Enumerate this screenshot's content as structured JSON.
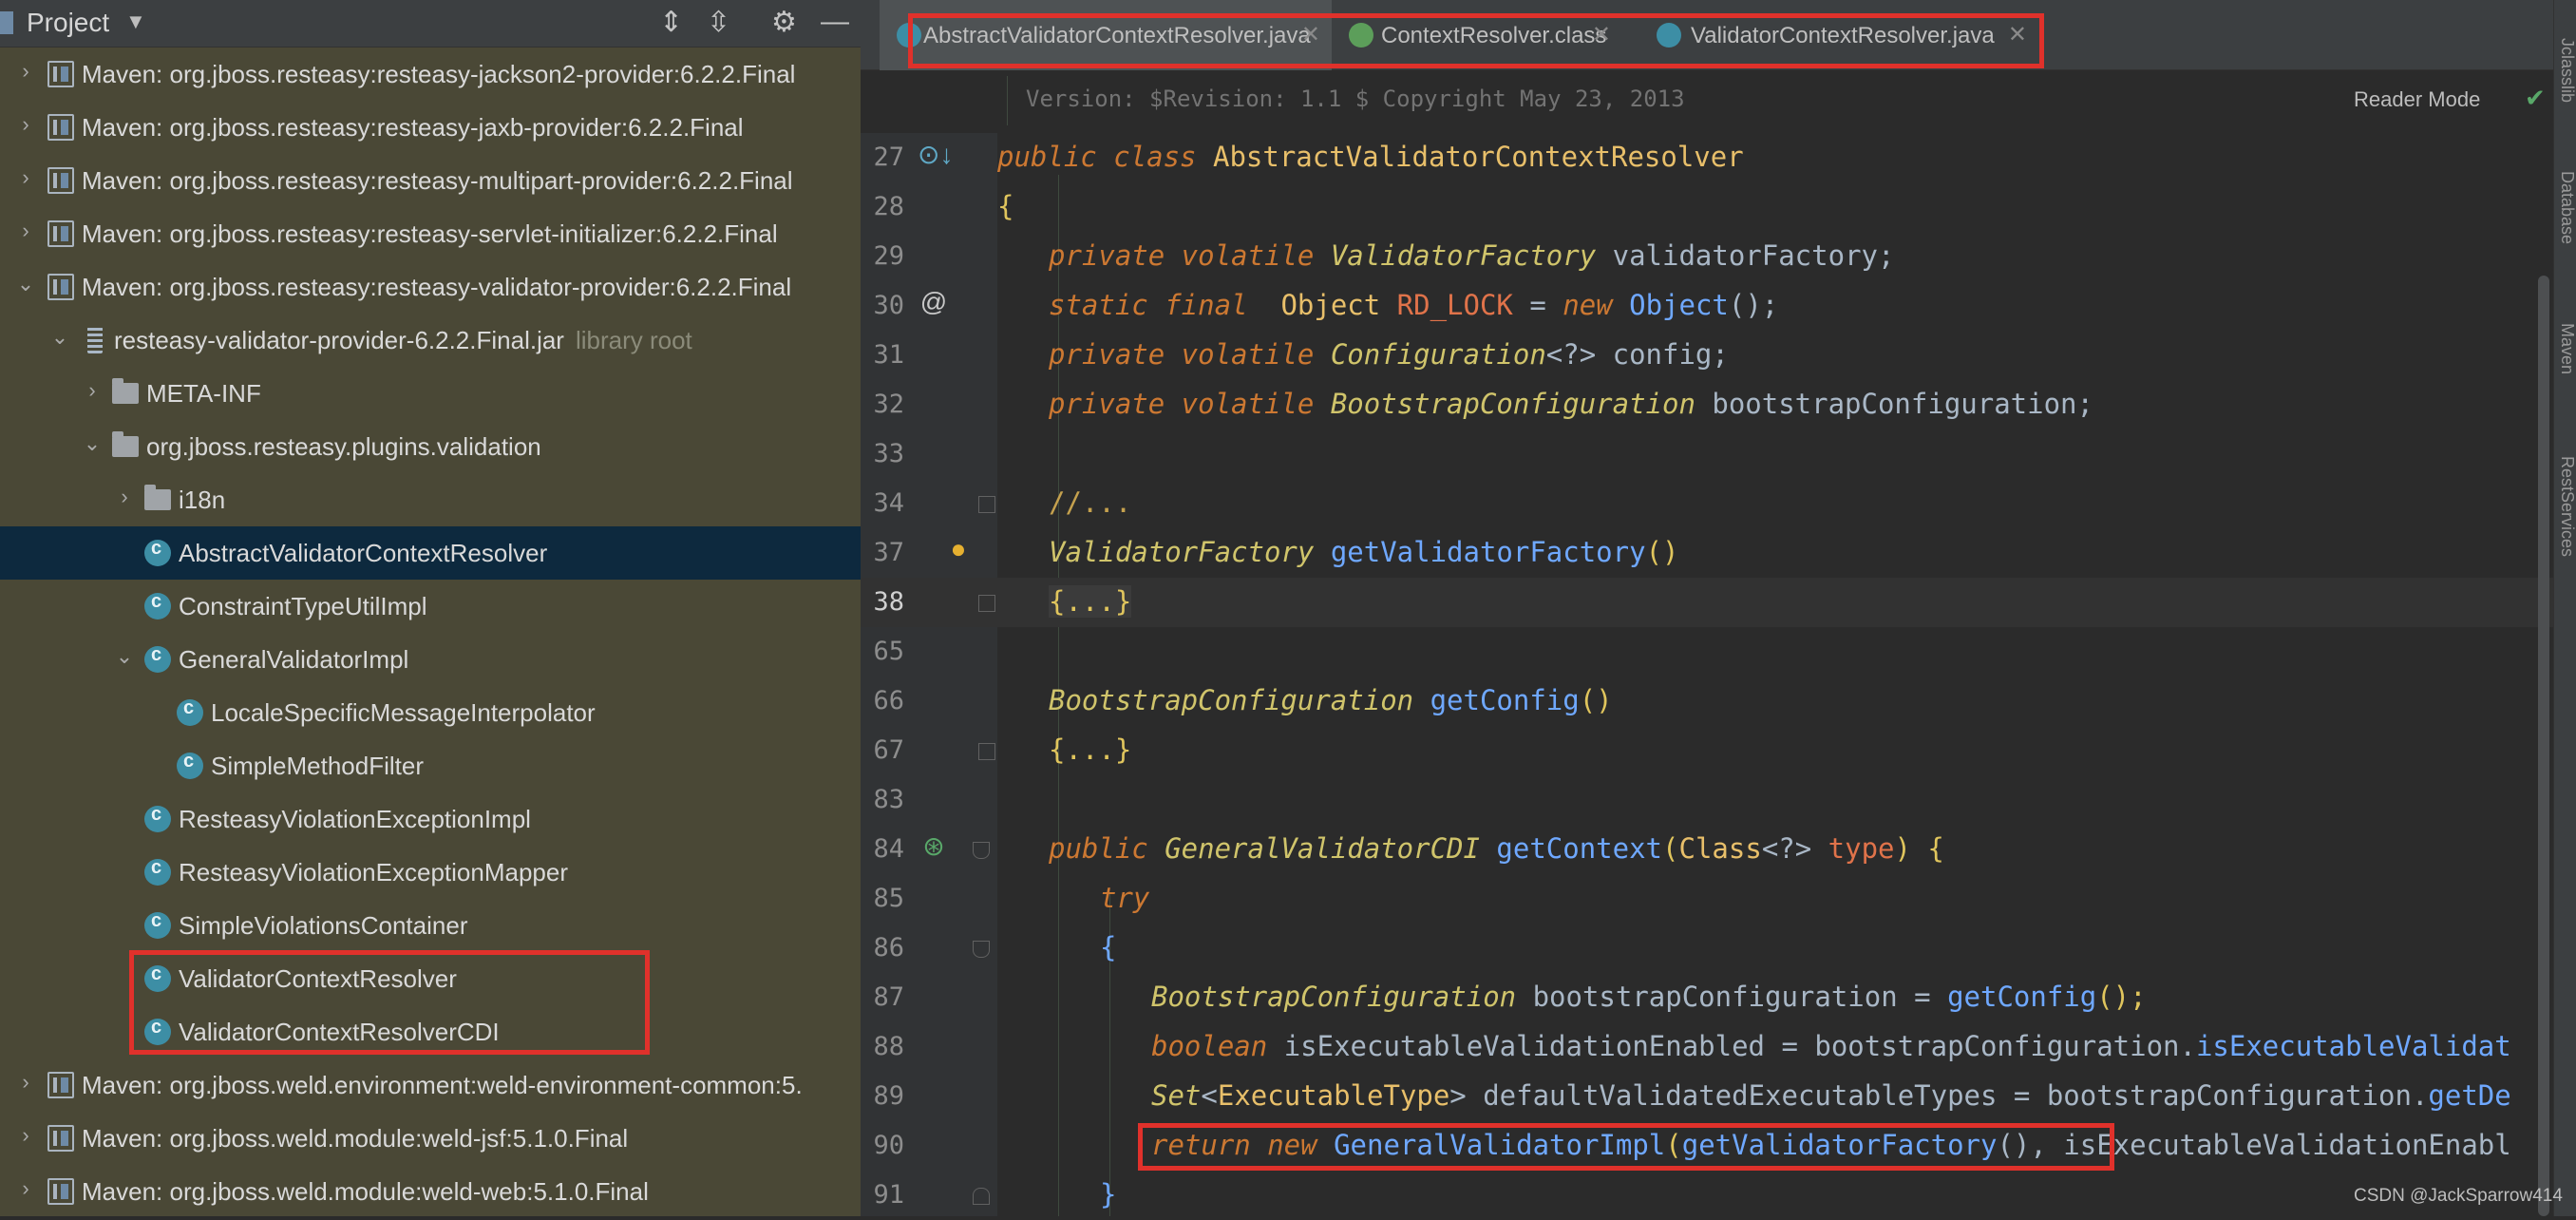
{
  "project": {
    "title": "Project",
    "items": [
      {
        "label": "Maven: org.jboss.resteasy:resteasy-jackson2-provider:6.2.2.Final"
      },
      {
        "label": "Maven: org.jboss.resteasy:resteasy-jaxb-provider:6.2.2.Final"
      },
      {
        "label": "Maven: org.jboss.resteasy:resteasy-multipart-provider:6.2.2.Final"
      },
      {
        "label": "Maven: org.jboss.resteasy:resteasy-servlet-initializer:6.2.2.Final"
      },
      {
        "label": "Maven: org.jboss.resteasy:resteasy-validator-provider:6.2.2.Final"
      },
      {
        "label": "resteasy-validator-provider-6.2.2.Final.jar",
        "suffix": "library root"
      },
      {
        "label": "META-INF"
      },
      {
        "label": "org.jboss.resteasy.plugins.validation"
      },
      {
        "label": "i18n"
      },
      {
        "label": "AbstractValidatorContextResolver"
      },
      {
        "label": "ConstraintTypeUtilImpl"
      },
      {
        "label": "GeneralValidatorImpl"
      },
      {
        "label": "LocaleSpecificMessageInterpolator"
      },
      {
        "label": "SimpleMethodFilter"
      },
      {
        "label": "ResteasyViolationExceptionImpl"
      },
      {
        "label": "ResteasyViolationExceptionMapper"
      },
      {
        "label": "SimpleViolationsContainer"
      },
      {
        "label": "ValidatorContextResolver"
      },
      {
        "label": "ValidatorContextResolverCDI"
      },
      {
        "label": "Maven: org.jboss.weld.environment:weld-environment-common:5."
      },
      {
        "label": "Maven: org.jboss.weld.module:weld-jsf:5.1.0.Final"
      },
      {
        "label": "Maven: org.jboss.weld.module:weld-web:5.1.0.Final"
      }
    ]
  },
  "tabs": [
    {
      "label": "AbstractValidatorContextResolver.java",
      "icon": "java-class-icon"
    },
    {
      "label": "ContextResolver.class",
      "icon": "interface-icon"
    },
    {
      "label": "ValidatorContextResolver.java",
      "icon": "java-class-icon"
    }
  ],
  "editor": {
    "header_note": "Version: $Revision: 1.1 $ Copyright May 23, 2013",
    "reader_mode": "Reader Mode",
    "lines": [
      {
        "n": "27",
        "t": [
          "public class ",
          "AbstractValidatorContextResolver"
        ]
      },
      {
        "n": "28",
        "t": [
          "{"
        ]
      },
      {
        "n": "29",
        "t": [
          "private volatile ",
          "ValidatorFactory",
          " validatorFactory;"
        ]
      },
      {
        "n": "30",
        "t": [
          "static final  ",
          "Object",
          " ",
          "RD_LOCK",
          " = ",
          "new ",
          "Object",
          "();"
        ]
      },
      {
        "n": "31",
        "t": [
          "private volatile ",
          "Configuration",
          "<?> config;"
        ]
      },
      {
        "n": "32",
        "t": [
          "private volatile ",
          "BootstrapConfiguration",
          " bootstrapConfiguration;"
        ]
      },
      {
        "n": "33",
        "t": []
      },
      {
        "n": "34",
        "t": [
          "//..."
        ]
      },
      {
        "n": "37",
        "t": [
          "ValidatorFactory",
          " ",
          "getValidatorFactory",
          "()"
        ]
      },
      {
        "n": "38",
        "t": [
          "{...}"
        ]
      },
      {
        "n": "65",
        "t": []
      },
      {
        "n": "66",
        "t": [
          "BootstrapConfiguration",
          " ",
          "getConfig",
          "()"
        ]
      },
      {
        "n": "67",
        "t": [
          "{...}"
        ]
      },
      {
        "n": "83",
        "t": []
      },
      {
        "n": "84",
        "t": [
          "public ",
          "GeneralValidatorCDI",
          " ",
          "getContext",
          "(",
          "Class",
          "<?> ",
          "type",
          ") {"
        ]
      },
      {
        "n": "85",
        "t": [
          "try"
        ]
      },
      {
        "n": "86",
        "t": [
          "{"
        ]
      },
      {
        "n": "87",
        "t": [
          "BootstrapConfiguration",
          " bootstrapConfiguration = ",
          "getConfig",
          "();"
        ]
      },
      {
        "n": "88",
        "t": [
          "boolean ",
          "isExecutableValidationEnabled = bootstrapConfiguration.",
          "isExecutableValidat"
        ]
      },
      {
        "n": "89",
        "t": [
          "Set",
          "<",
          "ExecutableType",
          "> defaultValidatedExecutableTypes = bootstrapConfiguration.",
          "getDe"
        ]
      },
      {
        "n": "90",
        "t": [
          "return new ",
          "GeneralValidatorImpl",
          "(",
          "getValidatorFactory",
          "(), isExecutableValidationEnabl"
        ]
      },
      {
        "n": "91",
        "t": [
          "}"
        ]
      }
    ]
  },
  "right_toolbar": [
    "Jclasslib",
    "Database",
    "Maven",
    "RestServices"
  ],
  "watermark": "CSDN @JackSparrow414",
  "colors": {
    "highlight": "#e0312b",
    "keyword": "#cc7832",
    "method": "#6fa8ff"
  }
}
